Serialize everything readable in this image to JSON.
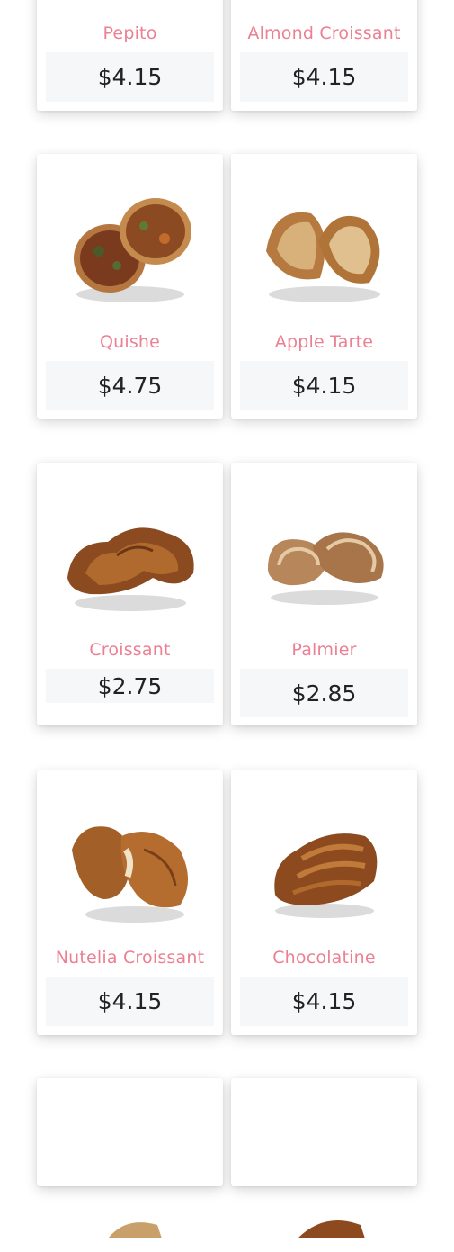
{
  "products": [
    {
      "name": "Pepito",
      "price": "$4.15",
      "image_icon": "pepito-pastry-image"
    },
    {
      "name": "Almond Croissant",
      "price": "$4.15",
      "image_icon": "almond-croissant-image"
    },
    {
      "name": "Quishe",
      "price": "$4.75",
      "image_icon": "quiche-image"
    },
    {
      "name": "Apple Tarte",
      "price": "$4.15",
      "image_icon": "apple-tart-image"
    },
    {
      "name": "Croissant",
      "price": "$2.75",
      "image_icon": "croissant-image"
    },
    {
      "name": "Palmier",
      "price": "$2.85",
      "image_icon": "palmier-image"
    },
    {
      "name": "Nutelia Croissant",
      "price": "$4.15",
      "image_icon": "nutella-croissant-image"
    },
    {
      "name": "Chocolatine",
      "price": "$4.15",
      "image_icon": "chocolatine-image"
    },
    {
      "name": "",
      "price": "",
      "image_icon": "pastry-image"
    },
    {
      "name": "",
      "price": "",
      "image_icon": "pastry-image"
    }
  ],
  "colors": {
    "name_text": "#ec7f92",
    "price_bg": "#f6f7f9",
    "price_text": "#222222"
  }
}
